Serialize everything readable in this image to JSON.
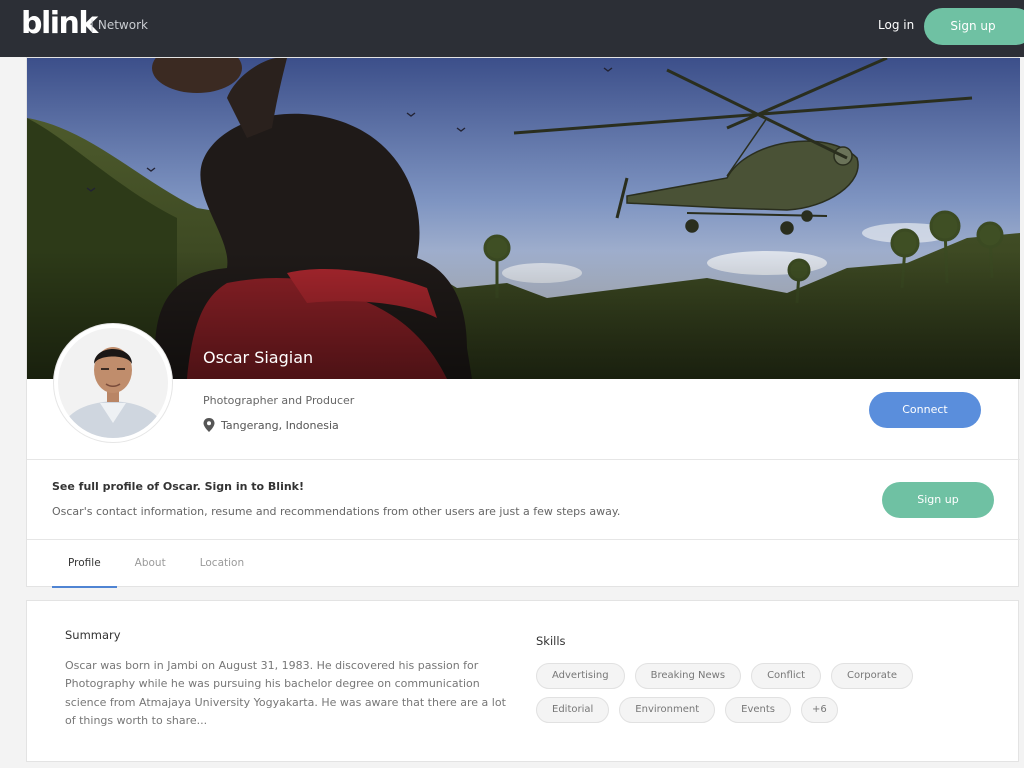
{
  "nav": {
    "logo": "blink",
    "section": "| Network",
    "login": "Log in",
    "signup": "Sign up"
  },
  "profile": {
    "name": "Oscar Siagian",
    "headline": "Photographer and Producer",
    "location": "Tangerang, Indonesia",
    "connect": "Connect"
  },
  "cta": {
    "title": "See full profile of Oscar. Sign in to Blink!",
    "text": "Oscar's contact information, resume and recommendations from other users are just a few steps away.",
    "signup": "Sign up"
  },
  "tabs": [
    {
      "label": "Profile",
      "active": true
    },
    {
      "label": "About",
      "active": false
    },
    {
      "label": "Location",
      "active": false
    }
  ],
  "summary": {
    "title": "Summary",
    "text": "Oscar was born in Jambi on August 31, 1983. He discovered his passion for Photography while he was pursuing his bachelor degree on communication science from Atmajaya University Yogyakarta. He was aware that there are a lot of things worth to share..."
  },
  "skills": {
    "title": "Skills",
    "items": [
      "Advertising",
      "Breaking News",
      "Conflict",
      "Corporate",
      "Editorial",
      "Environment",
      "Events"
    ],
    "more": "+6"
  },
  "colors": {
    "topbar": "#2c2f36",
    "signup_green": "#6fc1a3",
    "connect_blue": "#5a8edc",
    "tab_active": "#4f84d3"
  }
}
